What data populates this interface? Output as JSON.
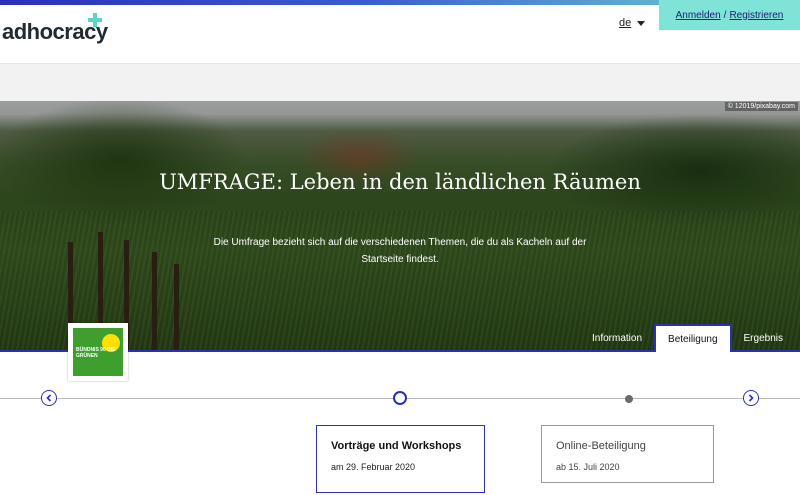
{
  "header": {
    "logo_text": "adhocracy",
    "language": "de",
    "login_label": "Anmelden",
    "separator": "/",
    "register_label": "Registrieren"
  },
  "hero": {
    "image_credit": "© 12019/pixabay.com",
    "title": "UMFRAGE: Leben in den ländlichen Räumen",
    "description": "Die Umfrage bezieht sich auf die verschiedenen Themen, die du als Kacheln auf der Startseite findest.",
    "org_logo_text": "BÜNDNIS 90 DIE GRÜNEN"
  },
  "tabs": [
    {
      "label": "Information",
      "active": false
    },
    {
      "label": "Beteiligung",
      "active": true
    },
    {
      "label": "Ergebnis",
      "active": false
    }
  ],
  "timeline": {
    "prev_icon": "chevron-left-icon",
    "next_icon": "chevron-right-icon"
  },
  "phases": [
    {
      "title": "Vorträge und Workshops",
      "date": "am 29. Februar 2020",
      "active": true
    },
    {
      "title": "Online-Beteiligung",
      "date": "ab 15. Juli 2020",
      "active": false
    }
  ],
  "colors": {
    "primary": "#2b2fb8",
    "accent": "#7fe3d8"
  }
}
